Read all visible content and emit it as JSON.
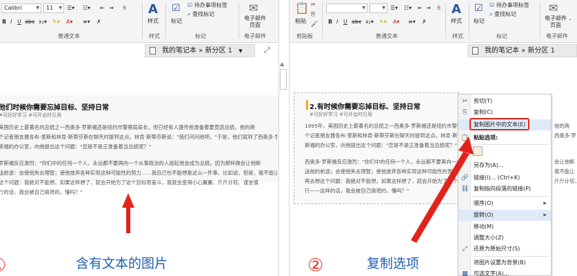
{
  "left_window": {
    "ribbon": {
      "font_name": "Calibri",
      "font_size": "11",
      "group_basic_text": "普通文本",
      "group_styles_label": "样式",
      "styles_button": "样式",
      "group_tags_label": "标记",
      "tags_button": "标记",
      "tag_todo": "待办事项标签",
      "tag_find": "查找标记",
      "email_button": "电子邮件页面",
      "email_line1": "电子邮件",
      "email_line2": "页面",
      "group_email_label": "电子邮件"
    },
    "notebook_section": "我的笔记本 » 新分区 1",
    "image": {
      "title": "他们时候你需要忘掉目标、坚持日常",
      "tags": "#可好好学习 #可开会时引用",
      "paragraphs": [
        [
          "美国历史上最著名的总统之一西奥多·罗斯福还是纽约市警察局局长，但已经有人盛传他准备着要竞选总统。他的两",
          "个记者朋友雅各布·里斯和林肯·斯蒂芬斯在聊天时提到这点。林肯·斯蒂芬斯说：\"我们问问他吧。\"于是，他们就到了西奥多·罗",
          "斯福的办公室，向他提出这个问题：\"您是不是正准备着当总统呢？\""
        ],
        [
          "罗斯福反应激烈：\"你们中的任何一个人，永远都不要再向一个从事政治的人提起他会成为总统。因为那样做会让他断",
          "送前途：会使他失去理智；使他放弃各种实现这种可能性的努力……我自己也不能想象这么一件事，比如说，但是，我不能让",
          "这个问题：我绝对不能想。如果这样想了，就会开始为了这个目标而奋斗，我就会变得小心翼翼、斤斤计较、谨言慎",
          "行的话，我会被自己搞垮的，懂吗？\""
        ]
      ]
    },
    "caption": "含有文本的图片",
    "step_number": "①"
  },
  "right_window": {
    "ribbon": {
      "paste_button": "粘贴",
      "group_clipboard_label": "剪贴板",
      "group_basic_text": "普通文本",
      "styles_button": "样式",
      "group_styles_label": "样式",
      "tags_button": "标记",
      "tag_todo": "待办事项标签",
      "tag_find": "查找标记",
      "group_tags_label": "标记",
      "email_line1": "电子邮件",
      "email_line2": "页面",
      "group_email_label": "电子邮件"
    },
    "notebook_section": "我的笔记本 » 新分区 1",
    "image": {
      "title": "2.有时候你需要忘掉目标、坚持日常",
      "tags": "#可好好学习 #可开会时引用",
      "paragraphs": [
        [
          "1895年，美国历史上最著名的总统之一西奥多·罗斯福还是纽约市警察局局长，",
          "个记者朋友雅各布·里斯和林肯·斯蒂芬斯在聊天时提到这点。林肯·斯蒂芬斯",
          "斯福的办公室，向他提出这个问题：\"您是不是正准备着当总统呢？\""
        ],
        [
          "西奥多·罗斯福反应激烈：\"你们中的任何一个人，永远都不要再向一个从事",
          "送他的前途；会使他失去理智；使他放弃各种实现这种可能性的努力……",
          "再去想这个问题：我绝对不能想。如果这样想了，就会开始为了这个目标而",
          "行——这样的话，我会被自己搞垮的，懂吗？\""
        ]
      ]
    },
    "context_menu": {
      "items": [
        {
          "icon": "scissors-icon",
          "glyph": "✂",
          "label": "剪切(T)"
        },
        {
          "icon": "copy-icon",
          "glyph": "⎘",
          "label": "复制(C)"
        },
        {
          "icon": "",
          "glyph": "",
          "label": "复制图片中的文本(E)"
        },
        {
          "icon": "paste-icon",
          "glyph": "📋",
          "label": "粘贴选项:"
        },
        {
          "icon": "",
          "glyph": "",
          "label": "另存为(A)..."
        },
        {
          "icon": "link-icon",
          "glyph": "🔗",
          "label": "链接(I)...    (Ctrl+K)"
        },
        {
          "icon": "",
          "glyph": "",
          "label": "复制指向段落的链接(P)"
        },
        {
          "icon": "",
          "glyph": "",
          "label": "顺序(O)"
        },
        {
          "icon": "",
          "glyph": "",
          "label": "旋转(O)"
        },
        {
          "icon": "",
          "glyph": "",
          "label": "移动(M)"
        },
        {
          "icon": "",
          "glyph": "",
          "label": "调整大小(Z)"
        },
        {
          "icon": "restore-size-icon",
          "glyph": "⤢",
          "label": "还原为原始尺寸(S)"
        },
        {
          "icon": "",
          "glyph": "",
          "label": "将图片设置为背景(B)"
        },
        {
          "icon": "",
          "glyph": "",
          "label": "可选文字(A)..."
        }
      ]
    },
    "caption": "复制选项",
    "step_number": "②",
    "edge_snippets": [
      "他的两",
      "西奥多·罗",
      "会让他断",
      "我不能让",
      "斤斤计较、"
    ]
  },
  "colors": {
    "annotation_red": "#e3231b",
    "caption_blue": "#1f5fb0",
    "title_bar_accent": "#f5a623"
  }
}
